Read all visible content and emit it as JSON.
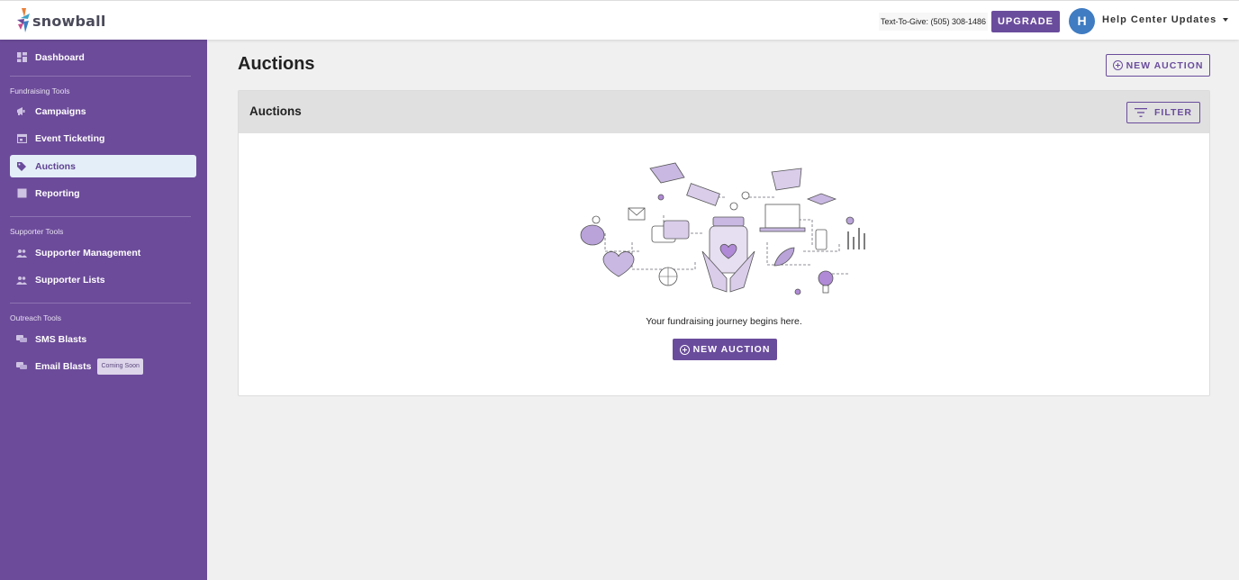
{
  "app": {
    "brand": "snowball"
  },
  "header": {
    "text_to_give": "Text-To-Give: (505) 308-1486",
    "upgrade_label": "UPGRADE",
    "avatar_initial": "H",
    "user_menu_label": "Help Center Updates"
  },
  "sidebar": {
    "dashboard": {
      "label": "Dashboard",
      "icon": "dashboard-icon"
    },
    "sections": [
      {
        "title": "Fundraising Tools",
        "items": [
          {
            "label": "Campaigns",
            "icon": "megaphone-icon"
          },
          {
            "label": "Event Ticketing",
            "icon": "calendar-icon"
          },
          {
            "label": "Auctions",
            "icon": "tag-icon",
            "active": true
          },
          {
            "label": "Reporting",
            "icon": "report-icon"
          }
        ]
      },
      {
        "title": "Supporter Tools",
        "items": [
          {
            "label": "Supporter Management",
            "icon": "people-icon"
          },
          {
            "label": "Supporter Lists",
            "icon": "people-icon"
          }
        ]
      },
      {
        "title": "Outreach Tools",
        "items": [
          {
            "label": "SMS Blasts",
            "icon": "chat-icon"
          },
          {
            "label": "Email Blasts",
            "icon": "chat-icon",
            "badge": "Coming Soon"
          }
        ]
      }
    ]
  },
  "main": {
    "title": "Auctions",
    "new_auction_label": "NEW AUCTION",
    "panel": {
      "title": "Auctions",
      "filter_label": "FILTER",
      "empty_message": "Your fundraising journey begins here.",
      "cta_label": "NEW AUCTION"
    }
  },
  "colors": {
    "brand_purple": "#6a4c9c",
    "sidebar_bg": "#6c4b9a",
    "active_item_bg": "#e4eef8",
    "avatar_blue": "#3f7cc2"
  }
}
